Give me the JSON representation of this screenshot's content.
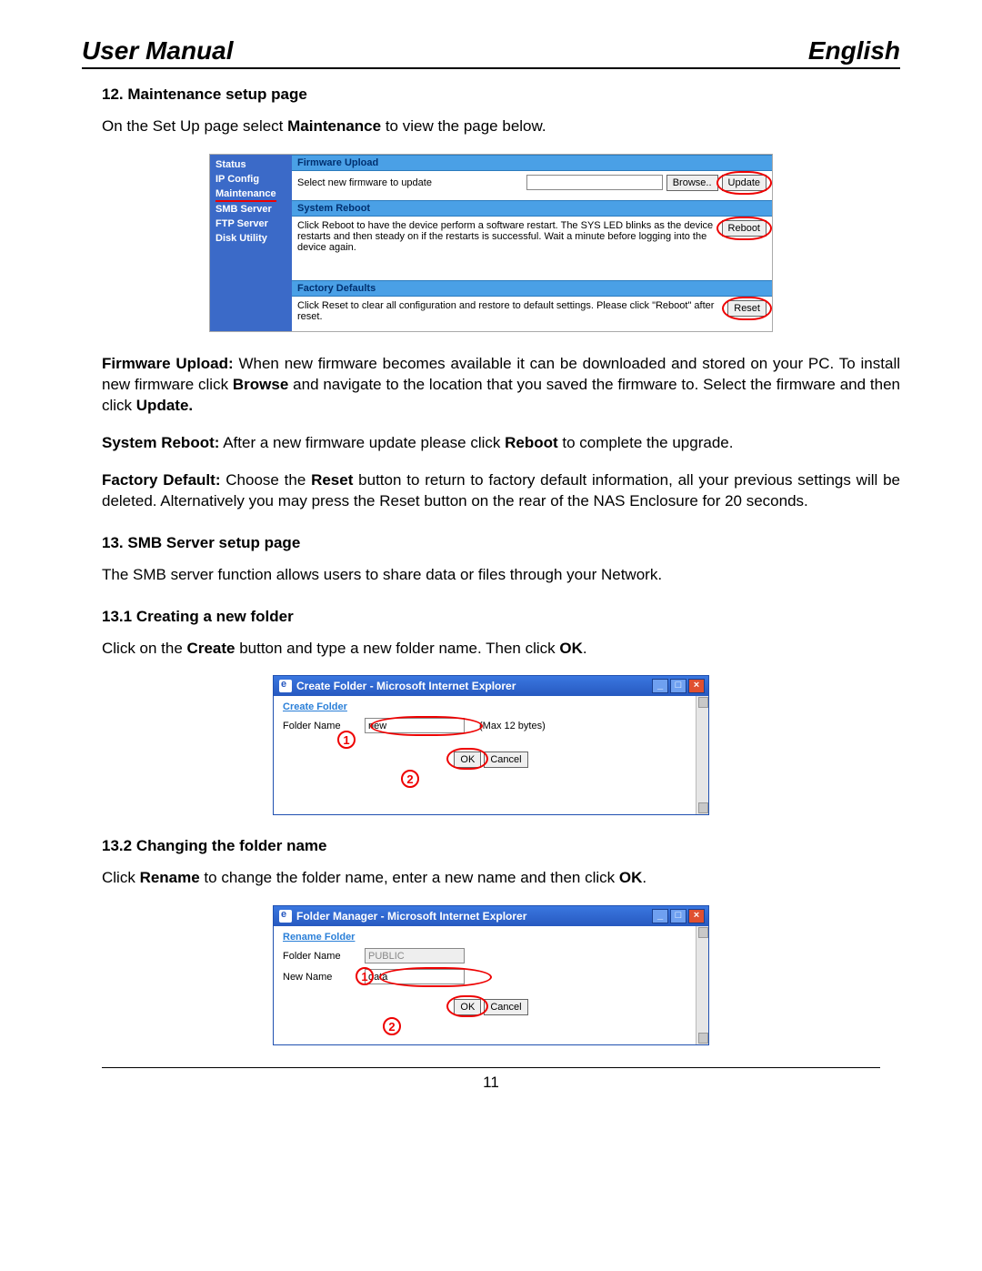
{
  "header": {
    "left": "User Manual",
    "right": "English"
  },
  "sections": {
    "s12": {
      "num": "12.",
      "title": "Maintenance setup page",
      "intro_pre": "On the Set Up page select ",
      "intro_bold": "Maintenance",
      "intro_post": " to view the page below."
    },
    "s13": {
      "num": "13.",
      "title": "SMB Server setup page",
      "intro": "The SMB server function allows users to share data or files through your Network."
    },
    "s13_1": {
      "num": "13.1",
      "title": "Creating a new folder",
      "text_pre": "Click on the ",
      "text_b1": "Create",
      "text_mid": " button and type a new folder name. Then click ",
      "text_b2": "OK",
      "text_post": "."
    },
    "s13_2": {
      "num": "13.2",
      "title": "Changing the folder name",
      "text_pre": "Click ",
      "text_b1": "Rename",
      "text_mid": " to change the folder name, enter a new name and then click ",
      "text_b2": "OK",
      "text_post": "."
    }
  },
  "fw_para": {
    "lead": "Firmware Upload:",
    "p1a": " When new firmware becomes available it can be downloaded and stored on your PC.  To install new firmware click ",
    "b1": "Browse",
    "p1b": " and navigate to the location that you saved the firmware to. Select the firmware and then click ",
    "b2": "Update.",
    "reboot_lead": "System Reboot:",
    "reboot_txt": " After a new firmware update please click ",
    "reboot_b": "Reboot",
    "reboot_post": " to complete the upgrade.",
    "fd_lead": "Factory Default:",
    "fd_a": " Choose the ",
    "fd_b": "Reset",
    "fd_c": " button to return to factory default information, all your previous settings will be deleted. Alternatively you may press the Reset button on the rear of the NAS Enclosure for 20 seconds."
  },
  "maint_fig": {
    "side_items": [
      "Status",
      "IP Config",
      "Maintenance",
      "SMB Server",
      "FTP Server",
      "Disk Utility"
    ],
    "sections": {
      "fw": {
        "bar": "Firmware Upload",
        "label": "Select new firmware to update",
        "browse": "Browse..",
        "update": "Update"
      },
      "reboot": {
        "bar": "System Reboot",
        "text": "Click Reboot to have the device perform a software restart. The SYS LED blinks as the device restarts and then steady on if the restarts is successful. Wait a minute before logging into the device again.",
        "btn": "Reboot"
      },
      "fd": {
        "bar": "Factory Defaults",
        "text": "Click Reset to clear all configuration and restore to default settings. Please click \"Reboot\" after reset.",
        "btn": "Reset"
      }
    }
  },
  "dlg_create": {
    "title": "Create Folder - Microsoft Internet Explorer",
    "section": "Create Folder",
    "label": "Folder Name",
    "value": "new",
    "hint": "(Max 12 bytes)",
    "ok": "OK",
    "cancel": "Cancel",
    "callout1": "1",
    "callout2": "2"
  },
  "dlg_rename": {
    "title": "Folder Manager - Microsoft Internet Explorer",
    "section": "Rename Folder",
    "label1": "Folder Name",
    "value1": "PUBLIC",
    "label2": "New Name",
    "value2": "data",
    "ok": "OK",
    "cancel": "Cancel",
    "callout1": "1",
    "callout2": "2"
  },
  "page_number": "11"
}
